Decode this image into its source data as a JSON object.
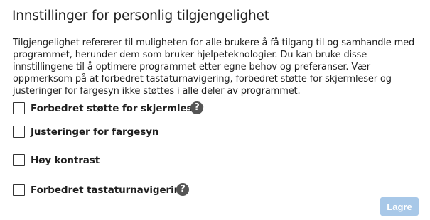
{
  "dialog": {
    "title": "Innstillinger for personlig tilgjengelighet",
    "description": "Tilgjengelighet refererer til muligheten for alle brukere å få tilgang til og samhandle med programmet, herunder dem som bruker hjelpeteknologier. Du kan bruke disse innstillingene til å optimere programmet etter egne behov og preferanser. Vær oppmerksom på at forbedret tastaturnavigering, forbedret støtte for skjermleser og justeringer for fargesyn ikke støttes i alle deler av programmet."
  },
  "options": [
    {
      "label": "Forbedret støtte for skjermleser",
      "checked": false,
      "has_help": true
    },
    {
      "label": "Justeringer for fargesyn",
      "checked": false,
      "has_help": false
    },
    {
      "label": "Høy kontrast",
      "checked": false,
      "has_help": false
    },
    {
      "label": "Forbedret tastaturnavigering",
      "checked": false,
      "has_help": true
    }
  ],
  "help_icon": {
    "glyph": "?",
    "icon": "question-circle-icon"
  },
  "actions": {
    "save_label": "Lagre",
    "save_enabled": false
  },
  "colors": {
    "save_button_disabled": "#a8c8e8",
    "help_icon": "#555555"
  }
}
